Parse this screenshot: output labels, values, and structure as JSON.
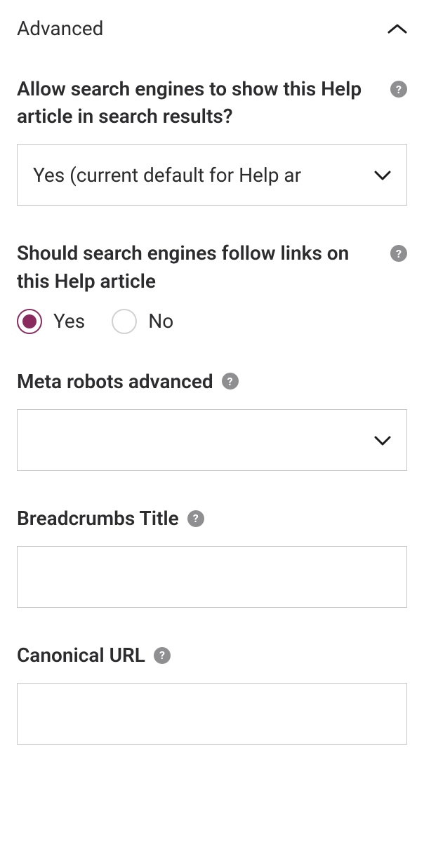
{
  "section": {
    "title": "Advanced"
  },
  "fields": {
    "allow_search": {
      "label": "Allow search engines to show this Help article in search results?",
      "value": "Yes (current default for Help ar"
    },
    "follow_links": {
      "label": "Should search engines follow links on this Help article",
      "options": {
        "yes": "Yes",
        "no": "No"
      },
      "selected": "yes"
    },
    "meta_robots": {
      "label": "Meta robots advanced",
      "value": ""
    },
    "breadcrumbs": {
      "label": "Breadcrumbs Title",
      "value": ""
    },
    "canonical": {
      "label": "Canonical URL",
      "value": ""
    }
  }
}
